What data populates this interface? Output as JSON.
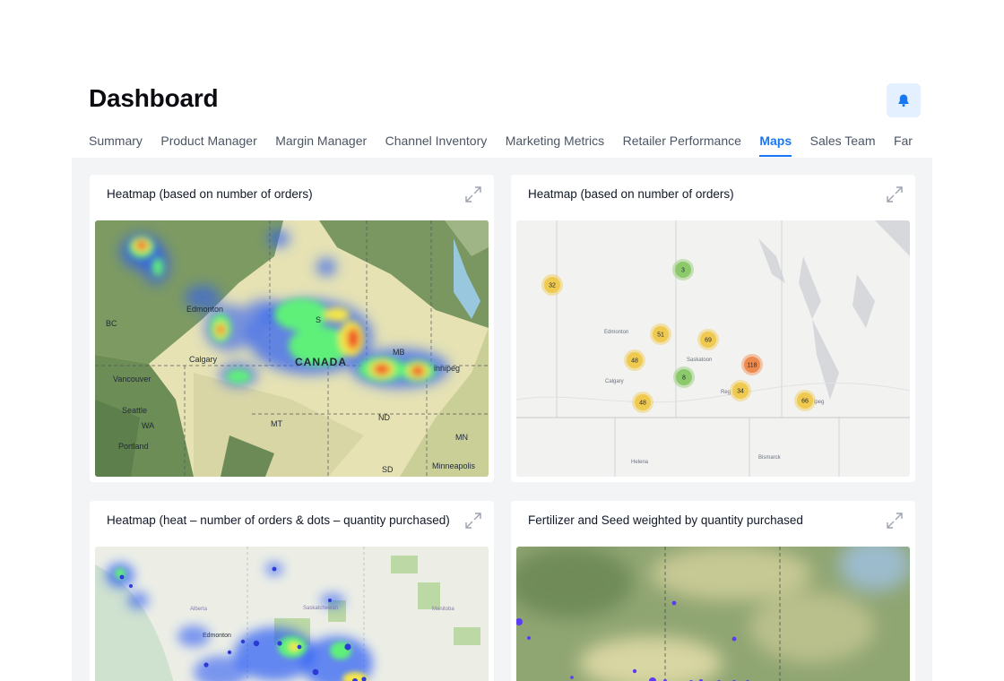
{
  "header": {
    "title": "Dashboard",
    "notification_icon": "bell-icon"
  },
  "tabs": [
    {
      "label": "Summary",
      "active": false
    },
    {
      "label": "Product Manager",
      "active": false
    },
    {
      "label": "Margin Manager",
      "active": false
    },
    {
      "label": "Channel Inventory",
      "active": false
    },
    {
      "label": "Marketing Metrics",
      "active": false
    },
    {
      "label": "Retailer Performance",
      "active": false
    },
    {
      "label": "Maps",
      "active": true
    },
    {
      "label": "Sales Team",
      "active": false
    },
    {
      "label": "Far",
      "active": false
    }
  ],
  "cards": [
    {
      "title": "Heatmap (based on number of orders)",
      "map_labels": {
        "edmonton": "Edmonton",
        "bc": "BC",
        "calgary": "Calgary",
        "vancouver": "Vancouver",
        "canada": "CANADA",
        "mb": "MB",
        "winnipeg": "innipeg",
        "seattle": "Seattle",
        "wa": "WA",
        "mt": "MT",
        "nd": "ND",
        "mn": "MN",
        "portland": "Portland",
        "sd": "SD",
        "minneapolis": "Minneapolis",
        "s": "S"
      }
    },
    {
      "title": "Heatmap (based on number of orders)",
      "map_labels": {
        "edmonton": "Edmonton",
        "saskatoon": "Saskatoon",
        "calgary": "Calgary",
        "regina": "Reg",
        "winnipeg": "ipeg",
        "helena": "Helena",
        "bismarck": "Bismarck"
      },
      "clusters": [
        {
          "count": "32",
          "level": "medium"
        },
        {
          "count": "3",
          "level": "low"
        },
        {
          "count": "51",
          "level": "medium"
        },
        {
          "count": "69",
          "level": "medium"
        },
        {
          "count": "48",
          "level": "medium"
        },
        {
          "count": "8",
          "level": "low"
        },
        {
          "count": "118",
          "level": "high"
        },
        {
          "count": "34",
          "level": "medium"
        },
        {
          "count": "48",
          "level": "medium"
        },
        {
          "count": "66",
          "level": "medium"
        }
      ]
    },
    {
      "title": "Heatmap (heat – number of orders & dots – quantity purchased)",
      "map_labels": {
        "alberta": "Alberta",
        "saskatchewan": "Saskatchewan",
        "manitoba": "Manitoba",
        "edmonton": "Edmonton"
      }
    },
    {
      "title": "Fertilizer and Seed weighted by quantity purchased"
    }
  ],
  "colors": {
    "accent": "#1877f2",
    "cluster_low": "#8bc96b",
    "cluster_medium": "#f0c94f",
    "cluster_high": "#ef8a4e",
    "heat_dot": "#5b3cf5"
  }
}
